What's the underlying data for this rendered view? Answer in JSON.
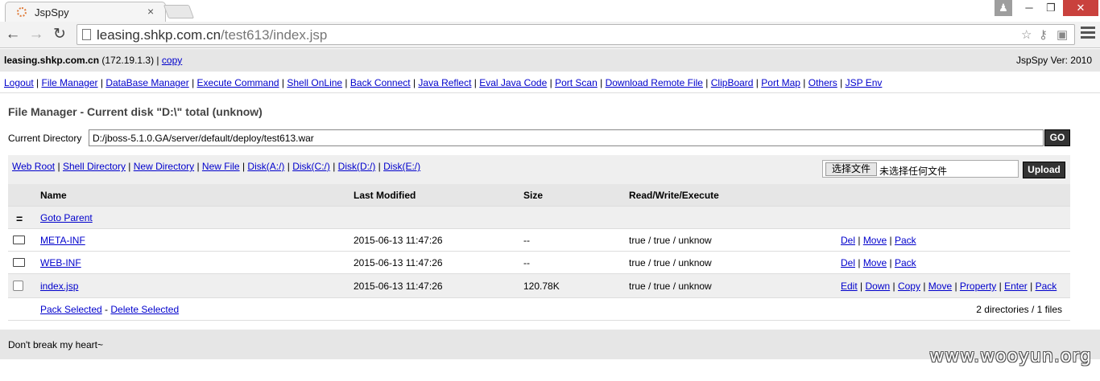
{
  "browser": {
    "tab_title": "JspSpy",
    "tab_close": "×",
    "url_host": "leasing.shkp.com.cn",
    "url_path": "/test613/index.jsp",
    "win_min": "─",
    "win_max": "❐",
    "win_close": "✕"
  },
  "host": {
    "name": "leasing.shkp.com.cn",
    "ip": " (172.19.1.3) | ",
    "copy": "copy",
    "version": "JspSpy Ver: 2010"
  },
  "menu": [
    "Logout",
    "File Manager",
    "DataBase Manager",
    "Execute Command",
    "Shell OnLine",
    "Back Connect",
    "Java Reflect",
    "Eval Java Code",
    "Port Scan",
    "Download Remote File",
    "ClipBoard",
    "Port Map",
    "Others",
    "JSP Env"
  ],
  "file_manager": {
    "title": "File Manager - Current disk \"D:\\\" total (unknow)",
    "current_dir_label": "Current Directory",
    "current_dir_value": "D:/jboss-5.1.0.GA/server/default/deploy/test613.war",
    "go_label": "GO",
    "shortcuts": [
      "Web Root",
      "Shell Directory",
      "New Directory",
      "New File",
      "Disk(A:/)",
      "Disk(C:/)",
      "Disk(D:/)",
      "Disk(E:/)"
    ],
    "choose_file": "选择文件",
    "no_file": "未选择任何文件",
    "upload_label": "Upload"
  },
  "table": {
    "headers": {
      "name": "Name",
      "modified": "Last Modified",
      "size": "Size",
      "rwx": "Read/Write/Execute"
    },
    "parent": {
      "icon": "=",
      "label": "Goto Parent"
    },
    "rows": [
      {
        "name": "META-INF",
        "modified": "2015-06-13 11:47:26",
        "size": "--",
        "rwx": "true / true / unknow",
        "actions": [
          "Del",
          "Move",
          "Pack"
        ]
      },
      {
        "name": "WEB-INF",
        "modified": "2015-06-13 11:47:26",
        "size": "--",
        "rwx": "true / true / unknow",
        "actions": [
          "Del",
          "Move",
          "Pack"
        ]
      },
      {
        "name": "index.jsp",
        "modified": "2015-06-13 11:47:26",
        "size": "120.78K",
        "rwx": "true / true / unknow",
        "actions": [
          "Edit",
          "Down",
          "Copy",
          "Move",
          "Property",
          "Enter",
          "Pack"
        ]
      }
    ],
    "pack_selected": "Pack Selected",
    "delete_selected": "Delete Selected",
    "count": "2 directories / 1 files"
  },
  "footer": "Don't break my heart~",
  "watermark": "www.wooyun.org"
}
